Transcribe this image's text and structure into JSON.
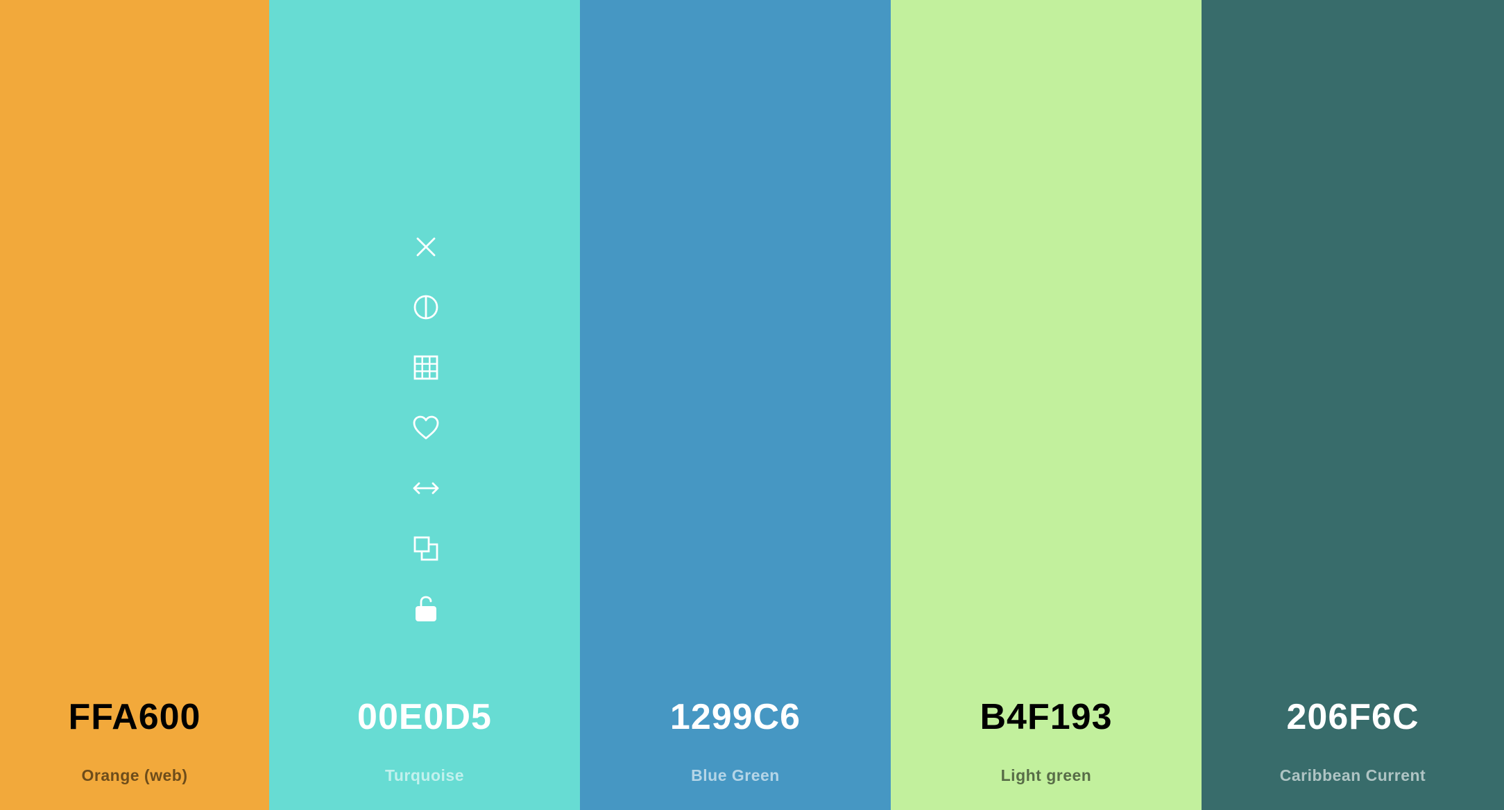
{
  "swatches": [
    {
      "hex": "FFA600",
      "name": "Orange (web)",
      "color": "#F2A93B",
      "text_theme": "dark"
    },
    {
      "hex": "00E0D5",
      "name": "Turquoise",
      "color": "#67DCD3",
      "text_theme": "light"
    },
    {
      "hex": "1299C6",
      "name": "Blue Green",
      "color": "#4697C3",
      "text_theme": "light"
    },
    {
      "hex": "B4F193",
      "name": "Light green",
      "color": "#C2F09D",
      "text_theme": "dark"
    },
    {
      "hex": "206F6C",
      "name": "Caribbean Current",
      "color": "#386C6B",
      "text_theme": "light"
    }
  ],
  "toolbar": {
    "swatch_index": 1,
    "tools": [
      {
        "icon": "close-icon"
      },
      {
        "icon": "contrast-icon"
      },
      {
        "icon": "grid-icon"
      },
      {
        "icon": "heart-icon"
      },
      {
        "icon": "drag-arrows-icon"
      },
      {
        "icon": "copy-icon"
      },
      {
        "icon": "unlock-icon"
      }
    ]
  }
}
